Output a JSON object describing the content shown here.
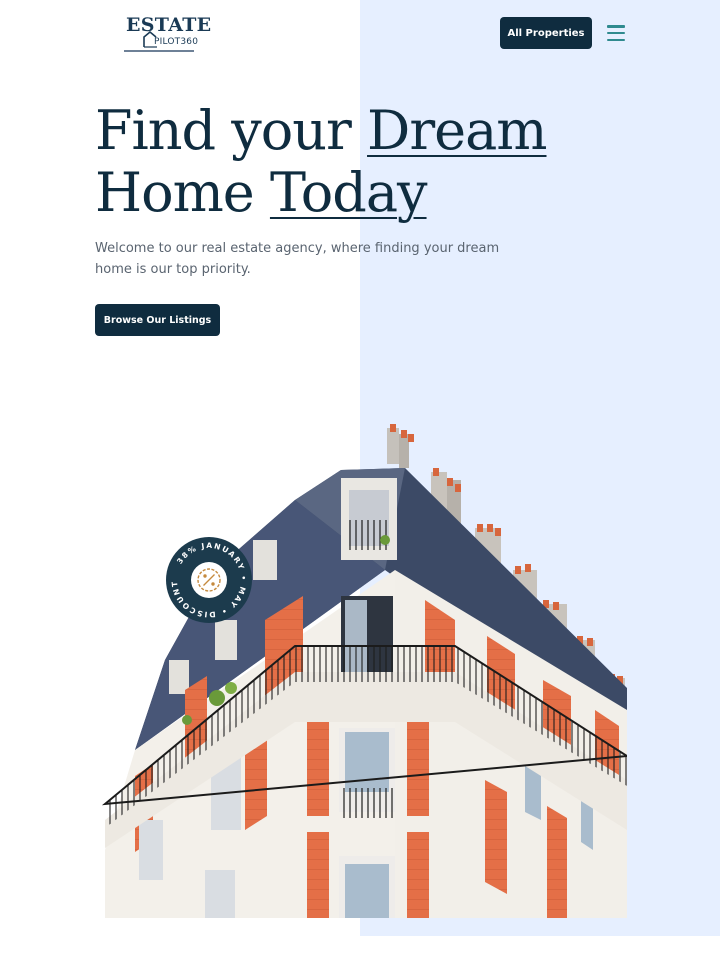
{
  "header": {
    "logo_line1": "ESTATE",
    "logo_line2": "PILOT360",
    "all_properties_label": "All Properties",
    "menu_icon": "hamburger-menu-icon"
  },
  "hero": {
    "title_part1": "Find your ",
    "title_part2": "Dream",
    "title_part3": "Home ",
    "title_part4": "Today",
    "subtitle": "Welcome to our real estate agency, where finding your dream home is our top priority.",
    "cta_label": "Browse Our Listings"
  },
  "badge": {
    "text": "38% JANUARY • MAY • DISCOUNT • ",
    "icon": "percent-badge-icon"
  },
  "colors": {
    "primary": "#0f2c3f",
    "accent_panel": "#e6efff",
    "menu_icon": "#2f8a8f",
    "brick": "#e2724a"
  }
}
